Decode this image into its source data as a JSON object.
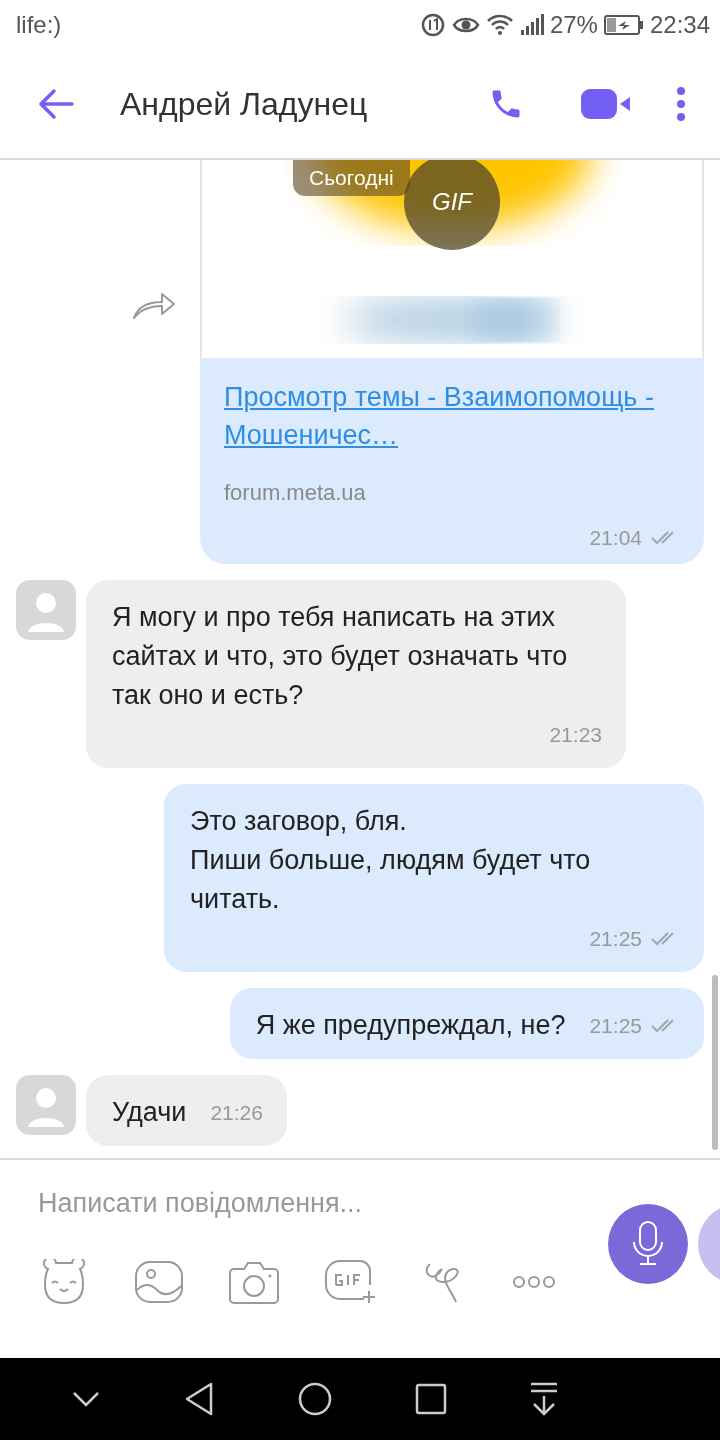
{
  "status_bar": {
    "carrier": "life:)",
    "battery": "27%",
    "time": "22:34"
  },
  "header": {
    "title": "Андрей Ладунец"
  },
  "date_chip": "Сьогодні",
  "messages": [
    {
      "kind": "link",
      "gif_label": "GIF",
      "title": "Просмотр темы - Взаимопомощь - Мошеничес…",
      "domain": "forum.meta.ua",
      "time": "21:04"
    },
    {
      "kind": "incoming",
      "text": "Я могу и про тебя написать на этих сайтах и что, это будет означать что так оно и есть?",
      "time": "21:23"
    },
    {
      "kind": "outgoing",
      "text": "Это заговор, бля.\nПиши больше, людям будет что читать.",
      "time": "21:25"
    },
    {
      "kind": "outgoing",
      "text": "Я же предупреждал, не?",
      "time": "21:25"
    },
    {
      "kind": "incoming",
      "text": "Удачи",
      "time": "21:26"
    }
  ],
  "composer": {
    "placeholder": "Написати повідомлення..."
  }
}
